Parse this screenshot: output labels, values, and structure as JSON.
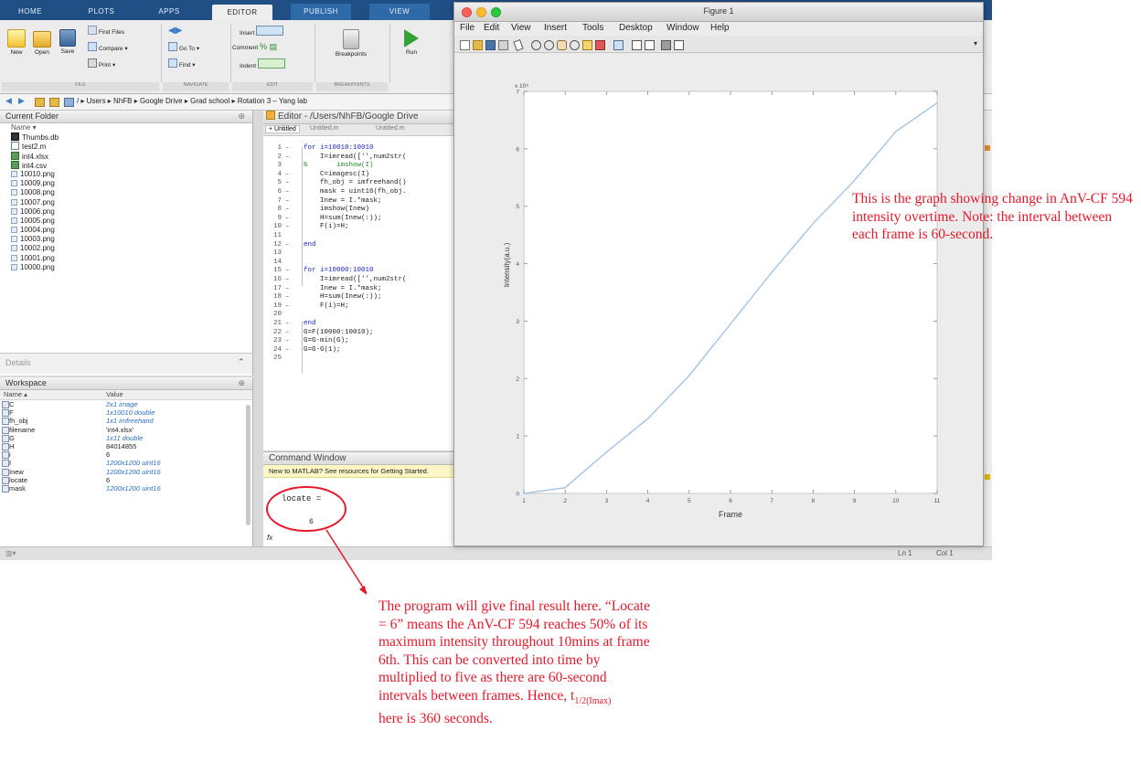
{
  "matlab": {
    "tabs": [
      "HOME",
      "PLOTS",
      "APPS",
      "EDITOR",
      "PUBLISH",
      "VIEW"
    ],
    "ribbon": {
      "new": "New",
      "open": "Open",
      "save": "Save",
      "find_files": "Find Files",
      "compare": "Compare ▾",
      "print": "Print ▾",
      "go_to": "Go To ▾",
      "find": "Find ▾",
      "insert": "Insert",
      "comment": "Comment",
      "indent": "Indent",
      "breakpoints": "Breakpoints",
      "run": "Run",
      "groups": [
        "FILE",
        "NAVIGATE",
        "EDIT",
        "BREAKPOINTS"
      ]
    },
    "address_path": "/ ▸ Users ▸ NhFB ▸ Google Drive ▸ Grad school ▸ Rotation 3 – Yang lab",
    "current_folder": {
      "title": "Current Folder",
      "column": "Name ▾",
      "files": [
        "Thumbs.db",
        "test2.m",
        "int4.xlsx",
        "int4.csv",
        "10010.png",
        "10009.png",
        "10008.png",
        "10007.png",
        "10006.png",
        "10005.png",
        "10004.png",
        "10003.png",
        "10002.png",
        "10001.png",
        "10000.png"
      ]
    },
    "details_label": "Details",
    "workspace": {
      "title": "Workspace",
      "col_name": "Name ▴",
      "col_value": "Value",
      "rows": [
        {
          "name": "C",
          "value": "2x1 image",
          "italic": true
        },
        {
          "name": "F",
          "value": "1x10010 double",
          "italic": true
        },
        {
          "name": "fh_obj",
          "value": "1x1 imfreehand",
          "italic": true
        },
        {
          "name": "filename",
          "value": "'int4.xlsx'",
          "italic": false
        },
        {
          "name": "G",
          "value": "1x11 double",
          "italic": true
        },
        {
          "name": "H",
          "value": "84014855",
          "italic": false
        },
        {
          "name": "i",
          "value": "6",
          "italic": false
        },
        {
          "name": "I",
          "value": "1200x1200 uint16",
          "italic": true
        },
        {
          "name": "Inew",
          "value": "1200x1200 uint16",
          "italic": true
        },
        {
          "name": "locate",
          "value": "6",
          "italic": false
        },
        {
          "name": "mask",
          "value": "1200x1200 uint16",
          "italic": true
        }
      ]
    },
    "editor": {
      "title": "Editor - /Users/NhFB/Google Drive",
      "tabs": [
        "+ Untitled",
        "Untitled.m",
        "Untitled.m"
      ],
      "code": [
        {
          "n": "1",
          "d": "–",
          "t": "for i=10010:10010"
        },
        {
          "n": "2",
          "d": "–",
          "t": "    I=imread(['',num2str("
        },
        {
          "n": "3",
          "d": "",
          "t": "%       imshow(I)"
        },
        {
          "n": "4",
          "d": "–",
          "t": "    C=imagesc(I)"
        },
        {
          "n": "5",
          "d": "–",
          "t": "    fh_obj = imfreehand()"
        },
        {
          "n": "6",
          "d": "–",
          "t": "    mask = uint16(fh_obj."
        },
        {
          "n": "7",
          "d": "–",
          "t": "    Inew = I.*mask;"
        },
        {
          "n": "8",
          "d": "–",
          "t": "    imshow(Inew)"
        },
        {
          "n": "9",
          "d": "–",
          "t": "    H=sum(Inew(:));"
        },
        {
          "n": "10",
          "d": "–",
          "t": "    F(i)=H;"
        },
        {
          "n": "11",
          "d": "",
          "t": ""
        },
        {
          "n": "12",
          "d": "–",
          "t": "end"
        },
        {
          "n": "13",
          "d": "",
          "t": ""
        },
        {
          "n": "14",
          "d": "",
          "t": ""
        },
        {
          "n": "15",
          "d": "–",
          "t": "for i=10000:10010"
        },
        {
          "n": "16",
          "d": "–",
          "t": "    I=imread(['',num2str("
        },
        {
          "n": "17",
          "d": "–",
          "t": "    Inew = I.*mask;"
        },
        {
          "n": "18",
          "d": "–",
          "t": "    H=sum(Inew(:));"
        },
        {
          "n": "19",
          "d": "–",
          "t": "    F(i)=H;"
        },
        {
          "n": "20",
          "d": "",
          "t": ""
        },
        {
          "n": "21",
          "d": "–",
          "t": "end"
        },
        {
          "n": "22",
          "d": "–",
          "t": "G=F(10000:10010);"
        },
        {
          "n": "23",
          "d": "–",
          "t": "G=G-min(G);"
        },
        {
          "n": "24",
          "d": "–",
          "t": "G=G-G(1);"
        },
        {
          "n": "25",
          "d": "",
          "t": ""
        }
      ]
    },
    "command_window": {
      "title": "Command Window",
      "notice": "New to MATLAB? See resources for Getting Started.",
      "output_var": "locate =",
      "output_value": "6",
      "prompt": "fx"
    },
    "status": {
      "line": "Ln  1",
      "col": "Col  1"
    }
  },
  "figure": {
    "window_title": "Figure 1",
    "menu": [
      "File",
      "Edit",
      "View",
      "Insert",
      "Tools",
      "Desktop",
      "Window",
      "Help"
    ],
    "exponent": "x 10⁸",
    "chart_data": {
      "type": "line",
      "x": [
        1,
        2,
        3,
        4,
        5,
        6,
        7,
        8,
        9,
        10,
        11
      ],
      "y": [
        0,
        0.1,
        0.72,
        1.3,
        2.05,
        2.95,
        3.85,
        4.7,
        5.45,
        6.3,
        6.8
      ],
      "xlabel": "Frame",
      "ylabel": "Intensity(a.u.)",
      "xlim": [
        1,
        11
      ],
      "ylim": [
        0,
        7
      ],
      "xticks": [
        "1",
        "2",
        "3",
        "4",
        "5",
        "6",
        "7",
        "8",
        "9",
        "10",
        "11"
      ],
      "yticks": [
        "0",
        "1",
        "2",
        "3",
        "4",
        "5",
        "6",
        "7"
      ],
      "line_color": "#9cc0e2",
      "grid": false
    }
  },
  "annotations": {
    "graph_note": "This is the graph showing change in AnV-CF 594 intensity overtime. Note: the interval between each frame is 60-second.",
    "result_note_main": "The program will give final result here. “Locate = 6” means the AnV-CF 594 reaches 50% of its maximum intensity throughout 10mins at frame 6th. This can be converted into time by multiplied to five as there are 60-second intervals between frames. Hence, t",
    "result_note_sub": "1/2(Imax)",
    "result_note_end": "here is 360 seconds.",
    "accent_color": "#e8182a"
  }
}
